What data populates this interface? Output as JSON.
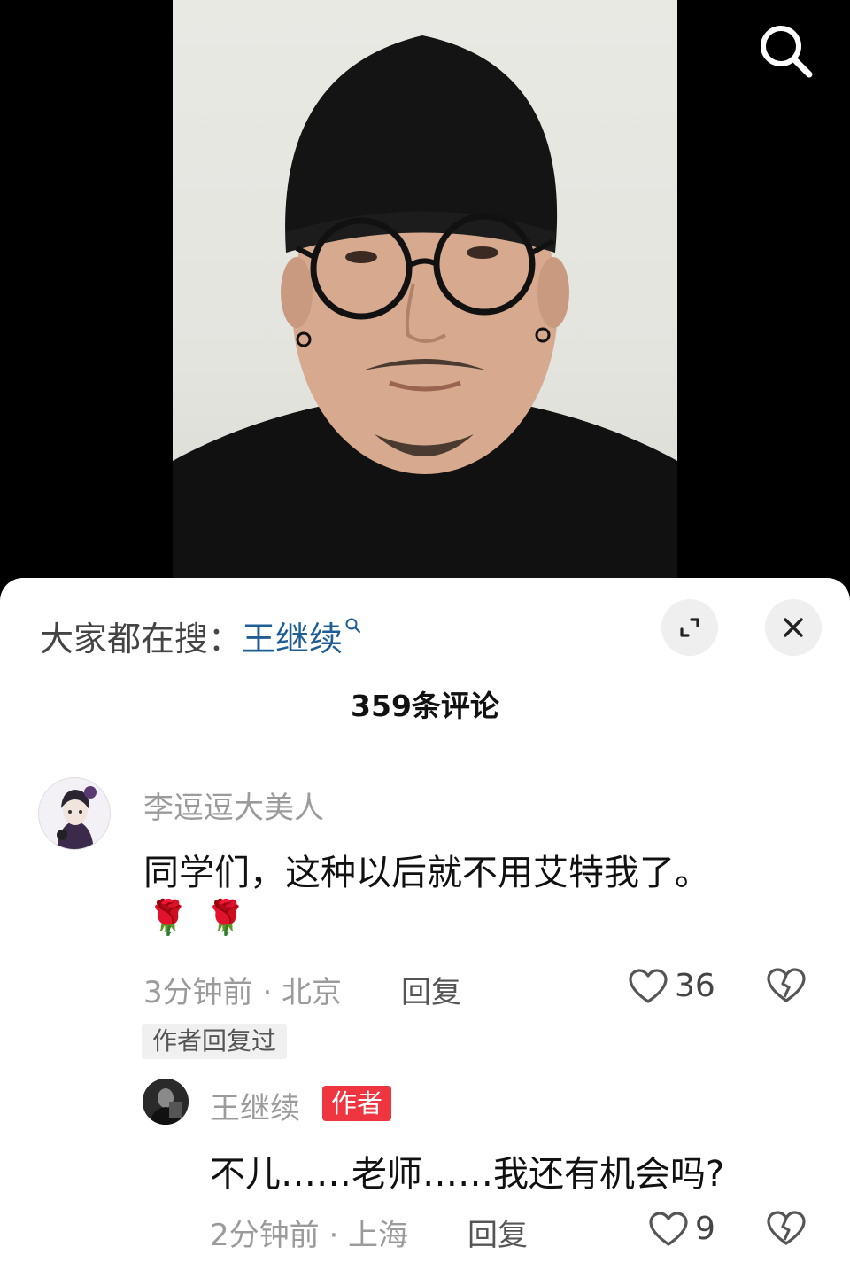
{
  "video": {
    "search_icon": "search-icon"
  },
  "sheet": {
    "hot_search_prefix": "大家都在搜：",
    "hot_search_term": "王继续",
    "expand_icon": "expand-icon",
    "close_icon": "close-icon",
    "comment_count": "359条评论"
  },
  "comments": [
    {
      "username": "李逗逗大美人",
      "text": "同学们，这种以后就不用艾特我了。",
      "emojis": [
        "🌹",
        "🌹"
      ],
      "meta": "3分钟前 · 北京",
      "reply_label": "回复",
      "likes": "36",
      "replied_tag": "作者回复过"
    },
    {
      "username": "王继续",
      "badge": "作者",
      "text": "不儿……老师……我还有机会吗?",
      "meta": "2分钟前 · 上海",
      "reply_label": "回复",
      "likes": "9"
    }
  ],
  "colors": {
    "link": "#1f5d95",
    "author_badge": "#ee3540",
    "muted": "#9b9b9b"
  }
}
